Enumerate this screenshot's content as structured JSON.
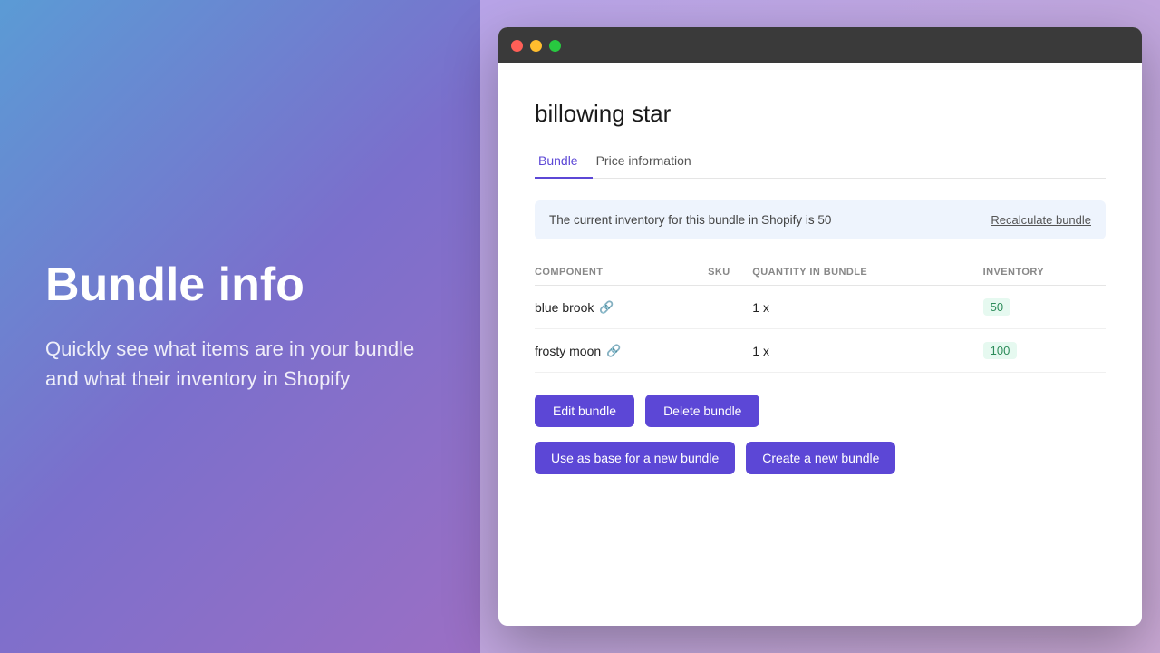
{
  "left": {
    "title": "Bundle info",
    "description": "Quickly see what items are in your bundle and what their inventory in Shopify"
  },
  "browser": {
    "bundle_title": "billowing star",
    "tabs": [
      {
        "label": "Bundle",
        "active": true
      },
      {
        "label": "Price information",
        "active": false
      }
    ],
    "info_banner": {
      "text": "The current inventory for this bundle in Shopify is 50",
      "action": "Recalculate bundle"
    },
    "table": {
      "headers": [
        "COMPONENT",
        "SKU",
        "QUANTITY IN BUNDLE",
        "INVENTORY"
      ],
      "rows": [
        {
          "component": "blue brook",
          "sku": "",
          "quantity": "1 x",
          "inventory": "50",
          "badge_color": "green"
        },
        {
          "component": "frosty moon",
          "sku": "",
          "quantity": "1 x",
          "inventory": "100",
          "badge_color": "green"
        }
      ]
    },
    "buttons_row1": {
      "edit": "Edit bundle",
      "delete": "Delete bundle"
    },
    "buttons_row2": {
      "base": "Use as base for a new bundle",
      "create": "Create a new bundle"
    }
  },
  "traffic_lights": {
    "red": "close",
    "yellow": "minimize",
    "green": "maximize"
  }
}
